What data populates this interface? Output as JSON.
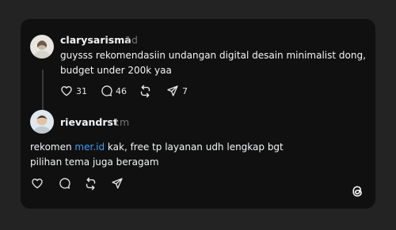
{
  "post": {
    "username": "clarysarisma",
    "time": "1d",
    "text_lines": [
      "guysss rekomendasiin undangan digital desain minimalist dong,",
      "budget under 200k yaa"
    ],
    "likes": "31",
    "replies": "46",
    "reposts": "",
    "shares": "7"
  },
  "reply": {
    "username": "rievandrst",
    "time": "1m",
    "line1_prefix": "rekomen ",
    "mention": "mer.id",
    "line1_suffix": " kak, free tp layanan udh lengkap bgt",
    "line2": "pilihan tema juga beragam"
  },
  "icons": {
    "like": "heart-icon",
    "reply": "comment-icon",
    "repost": "repost-icon",
    "share": "share-icon",
    "brand": "threads-logo-icon"
  },
  "colors": {
    "background": "#232323",
    "card": "#101010",
    "text": "#f3f5f7",
    "muted": "#777777",
    "link": "#3d9df7"
  }
}
